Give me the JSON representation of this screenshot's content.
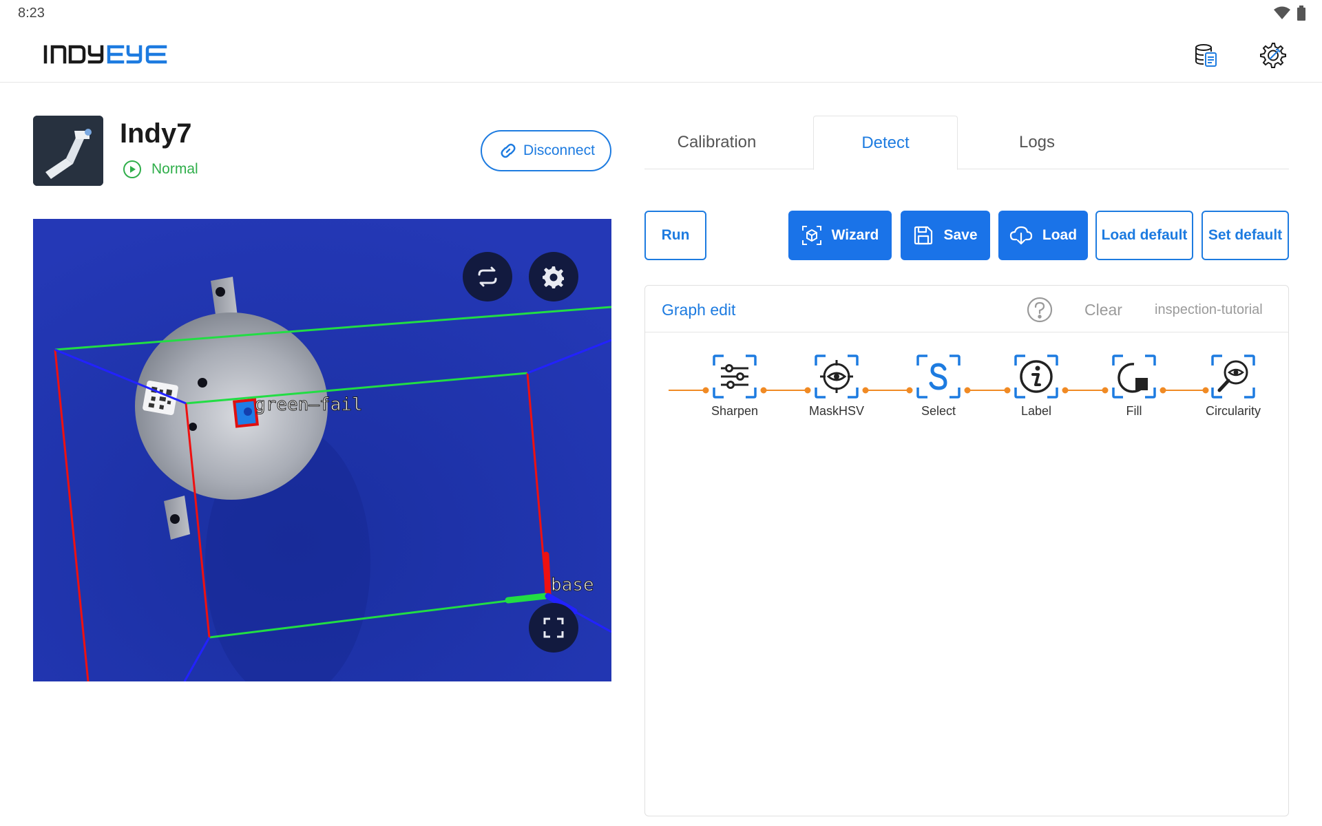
{
  "status_bar": {
    "time": "8:23"
  },
  "app": {
    "logo_text": "INDYEYE"
  },
  "robot": {
    "name": "Indy7",
    "status": "Normal",
    "disconnect_label": "Disconnect"
  },
  "camera": {
    "annotations": [
      {
        "label": "green—fail"
      },
      {
        "label": "base"
      }
    ]
  },
  "tabs": [
    {
      "label": "Calibration",
      "active": false
    },
    {
      "label": "Detect",
      "active": true
    },
    {
      "label": "Logs",
      "active": false
    }
  ],
  "toolbar": {
    "run": "Run",
    "wizard": "Wizard",
    "save": "Save",
    "load": "Load",
    "load_default": "Load default",
    "set_default": "Set default"
  },
  "graph": {
    "title": "Graph edit",
    "clear": "Clear",
    "name": "inspection-tutorial",
    "nodes": [
      {
        "label": "Sharpen",
        "icon": "sliders-icon"
      },
      {
        "label": "MaskHSV",
        "icon": "eye-target-icon"
      },
      {
        "label": "Select",
        "icon": "select-s-icon"
      },
      {
        "label": "Label",
        "icon": "info-icon"
      },
      {
        "label": "Fill",
        "icon": "fill-icon"
      },
      {
        "label": "Circularity",
        "icon": "magnifier-eye-icon"
      }
    ]
  },
  "colors": {
    "accent": "#1d7be0",
    "button_fill": "#1a73e8",
    "status_ok": "#2fae4a",
    "pipeline_line": "#f08a24"
  }
}
